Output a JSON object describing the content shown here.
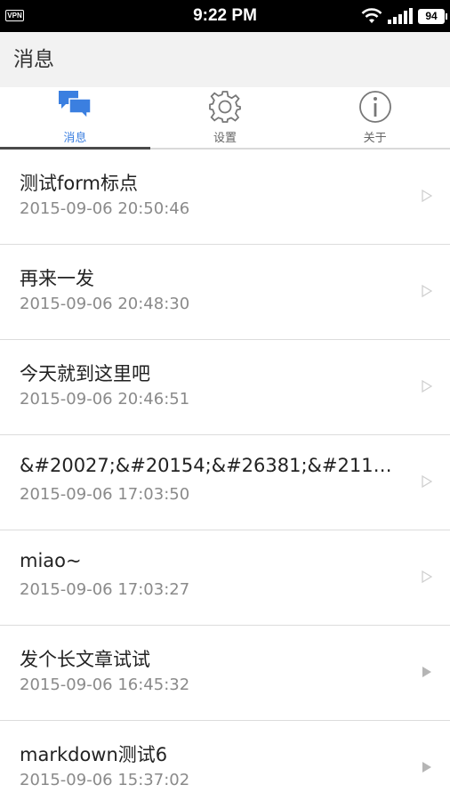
{
  "status_bar": {
    "vpn_label": "VPN",
    "time": "9:22 PM",
    "battery": "94"
  },
  "app_bar": {
    "title": "消息"
  },
  "tabs": [
    {
      "label": "消息",
      "icon": "messages-icon",
      "active": true
    },
    {
      "label": "设置",
      "icon": "gear-icon",
      "active": false
    },
    {
      "label": "关于",
      "icon": "info-icon",
      "active": false
    }
  ],
  "colors": {
    "accent": "#3b7fe0",
    "arrow_outline": "#cfcfcf",
    "arrow_filled": "#b5b5b5"
  },
  "messages": [
    {
      "title": "测试form标点",
      "time": "2015-09-06 20:50:46",
      "arrow": "outline"
    },
    {
      "title": "再来一发",
      "time": "2015-09-06 20:48:30",
      "arrow": "outline"
    },
    {
      "title": "今天就到这里吧",
      "time": "2015-09-06 20:46:51",
      "arrow": "outline"
    },
    {
      "title": "&#20027;&#20154;&#26381;&#21153;&..",
      "time": "2015-09-06 17:03:50",
      "arrow": "outline"
    },
    {
      "title": "miao~",
      "time": "2015-09-06 17:03:27",
      "arrow": "outline"
    },
    {
      "title": "发个长文章试试",
      "time": "2015-09-06 16:45:32",
      "arrow": "filled"
    },
    {
      "title": "markdown测试6",
      "time": "2015-09-06 15:37:02",
      "arrow": "filled"
    }
  ]
}
